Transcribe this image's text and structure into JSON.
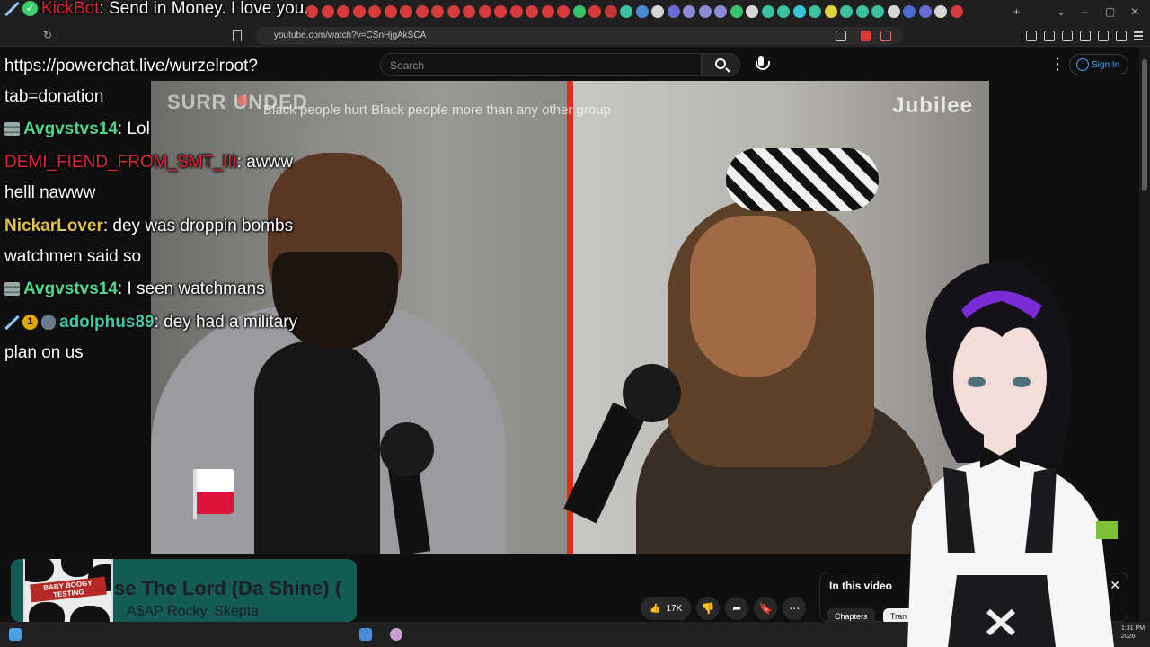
{
  "browser": {
    "url": "youtube.com/watch?v=CSnHjgAkSCA",
    "colors": {
      "chrome_bg": "#1f1f1f",
      "address_bg": "#2b2b2b"
    }
  },
  "youtube": {
    "search_placeholder": "Search",
    "signin_label": "Sign In",
    "like_count": "17K",
    "in_this_video": {
      "title": "In this video",
      "chips": [
        "Chapters",
        "Tran"
      ]
    }
  },
  "video": {
    "brand_left": "SURR UNDED",
    "caption": "Black people hurt Black people more than any other group",
    "brand_right": "Jubilee"
  },
  "chat": {
    "messages": [
      {
        "user": "KickBot",
        "text": ": Send in Money. I love you.",
        "color": "#e0243a"
      },
      {
        "user": "https://powerchat.live/wurzelroot?tab=donation",
        "text": "",
        "color": "#ffffff"
      },
      {
        "user": "Avgvstvs14",
        "text": ": Lol",
        "color": "#4fd68a"
      },
      {
        "user": "DEMI_FIEND_FROM_SMT_III",
        "text": ": awww helll nawww",
        "color": "#e0243a"
      },
      {
        "user": "NickarLover",
        "text": ": dey was droppin bombs watchmen said so",
        "color": "#e0c248"
      },
      {
        "user": "Avgvstvs14",
        "text": ": I seen watchmans",
        "color": "#4fd68a"
      },
      {
        "user": "adolphus89",
        "text": ": dey had a military plan on us",
        "color": "#3fc9a8"
      }
    ],
    "badge_number": "1"
  },
  "now_playing": {
    "song": "se The Lord (Da Shine) (",
    "artist": "A$AP Rocky, Skepta",
    "art_text": "BABY BOOGY TESTING"
  },
  "clock": {
    "time": "1:31 PM",
    "date": "2026"
  }
}
